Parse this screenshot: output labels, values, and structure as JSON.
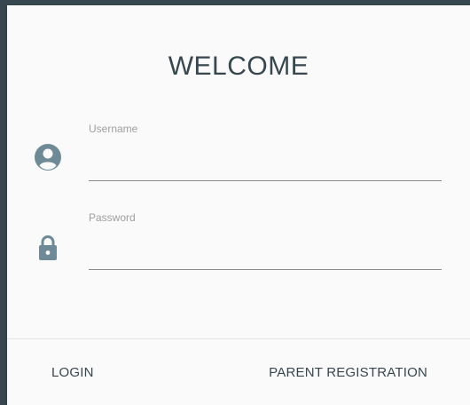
{
  "form": {
    "title": "WELCOME",
    "username": {
      "label": "Username",
      "value": "",
      "icon": "account-circle-icon"
    },
    "password": {
      "label": "Password",
      "value": "",
      "icon": "lock-icon"
    }
  },
  "actions": {
    "login_label": "LOGIN",
    "register_label": "PARENT REGISTRATION"
  },
  "colors": {
    "frame": "#37474f",
    "card": "#fafafa",
    "icon": "#6f8a97",
    "text": "#37474f"
  }
}
